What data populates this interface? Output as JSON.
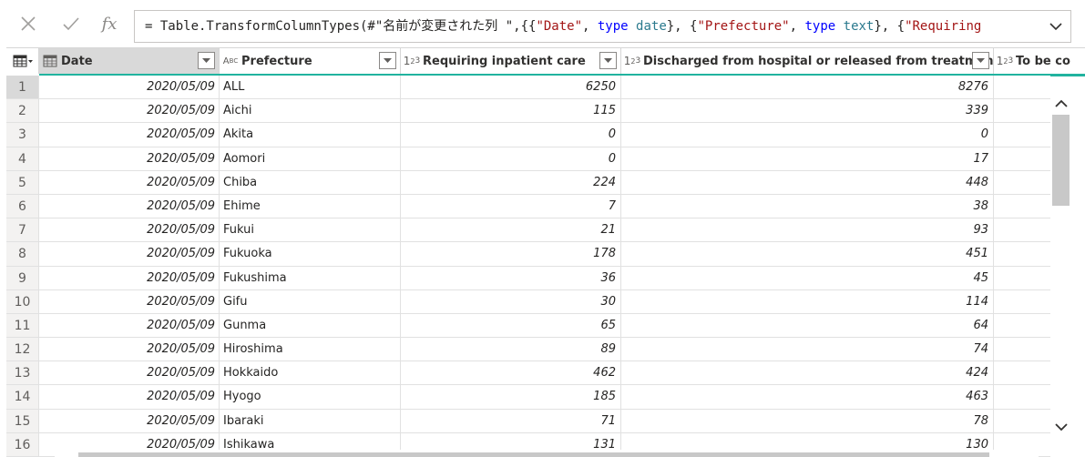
{
  "formula_bar": {
    "cancel_icon": "close-icon",
    "commit_icon": "check-icon",
    "fx_label": "fx",
    "formula_parts": [
      {
        "text": "= Table.TransformColumnTypes(#\"名前が変更された列 \",{{",
        "kind": "plain"
      },
      {
        "text": "\"Date\"",
        "kind": "str"
      },
      {
        "text": ", ",
        "kind": "plain"
      },
      {
        "text": "type",
        "kind": "kw"
      },
      {
        "text": " ",
        "kind": "plain"
      },
      {
        "text": "date",
        "kind": "ty"
      },
      {
        "text": "}, {",
        "kind": "plain"
      },
      {
        "text": "\"Prefecture\"",
        "kind": "str"
      },
      {
        "text": ", ",
        "kind": "plain"
      },
      {
        "text": "type",
        "kind": "kw"
      },
      {
        "text": " ",
        "kind": "plain"
      },
      {
        "text": "text",
        "kind": "ty"
      },
      {
        "text": "}, {",
        "kind": "plain"
      },
      {
        "text": "\"Requiring",
        "kind": "str"
      }
    ],
    "expand_icon": "chevron-down-icon"
  },
  "columns": [
    {
      "key": "date",
      "name": "Date",
      "type_icon": "calendar-icon"
    },
    {
      "key": "pref",
      "name": "Prefecture",
      "type_icon": "ABC"
    },
    {
      "key": "req",
      "name": "Requiring inpatient care",
      "type_icon": "123"
    },
    {
      "key": "dis",
      "name": "Discharged from hospital or released from treatment",
      "type_icon": "123"
    },
    {
      "key": "tobe",
      "name": "To be co",
      "type_icon": "123"
    }
  ],
  "rows": [
    {
      "n": "1",
      "date": "2020/05/09",
      "pref": "ALL",
      "req": "6250",
      "dis": "8276"
    },
    {
      "n": "2",
      "date": "2020/05/09",
      "pref": "Aichi",
      "req": "115",
      "dis": "339"
    },
    {
      "n": "3",
      "date": "2020/05/09",
      "pref": "Akita",
      "req": "0",
      "dis": "0"
    },
    {
      "n": "4",
      "date": "2020/05/09",
      "pref": "Aomori",
      "req": "0",
      "dis": "17"
    },
    {
      "n": "5",
      "date": "2020/05/09",
      "pref": "Chiba",
      "req": "224",
      "dis": "448"
    },
    {
      "n": "6",
      "date": "2020/05/09",
      "pref": "Ehime",
      "req": "7",
      "dis": "38"
    },
    {
      "n": "7",
      "date": "2020/05/09",
      "pref": "Fukui",
      "req": "21",
      "dis": "93"
    },
    {
      "n": "8",
      "date": "2020/05/09",
      "pref": "Fukuoka",
      "req": "178",
      "dis": "451"
    },
    {
      "n": "9",
      "date": "2020/05/09",
      "pref": "Fukushima",
      "req": "36",
      "dis": "45"
    },
    {
      "n": "10",
      "date": "2020/05/09",
      "pref": "Gifu",
      "req": "30",
      "dis": "114"
    },
    {
      "n": "11",
      "date": "2020/05/09",
      "pref": "Gunma",
      "req": "65",
      "dis": "64"
    },
    {
      "n": "12",
      "date": "2020/05/09",
      "pref": "Hiroshima",
      "req": "89",
      "dis": "74"
    },
    {
      "n": "13",
      "date": "2020/05/09",
      "pref": "Hokkaido",
      "req": "462",
      "dis": "424"
    },
    {
      "n": "14",
      "date": "2020/05/09",
      "pref": "Hyogo",
      "req": "185",
      "dis": "463"
    },
    {
      "n": "15",
      "date": "2020/05/09",
      "pref": "Ibaraki",
      "req": "71",
      "dis": "78"
    },
    {
      "n": "16",
      "date": "2020/05/09",
      "pref": "Ishikawa",
      "req": "131",
      "dis": "130"
    }
  ],
  "colors": {
    "accent": "#21b39f",
    "selected_header": "#d9d9d9"
  }
}
